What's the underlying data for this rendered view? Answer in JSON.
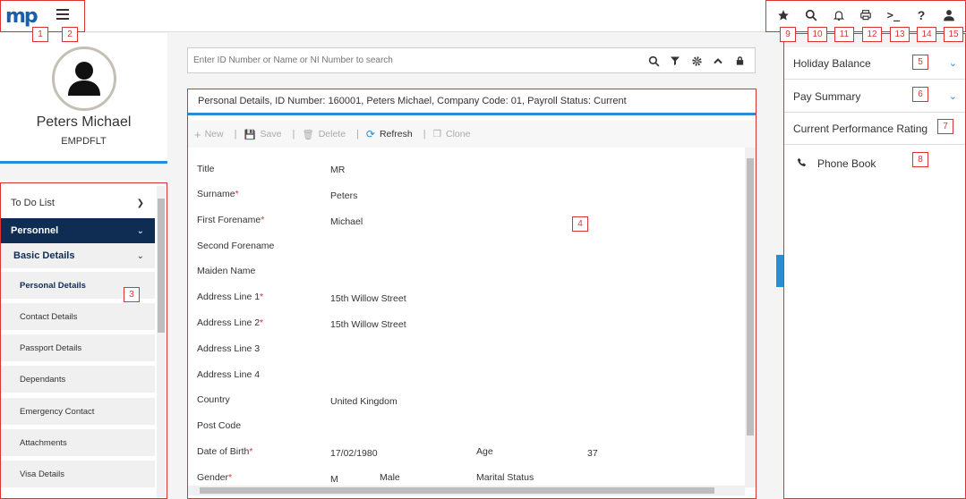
{
  "app": {
    "logo": "mp"
  },
  "top_icons": [
    "star-icon",
    "search-icon",
    "bell-icon",
    "print-icon",
    "terminal-icon",
    "help-icon",
    "user-icon"
  ],
  "annotations": [
    "1",
    "2",
    "3",
    "4",
    "5",
    "6",
    "7",
    "8",
    "9",
    "10",
    "11",
    "12",
    "13",
    "14",
    "15"
  ],
  "profile": {
    "name": "Peters Michael",
    "code": "EMPDFLT"
  },
  "nav": {
    "todo": "To Do List",
    "personnel": "Personnel",
    "basic": "Basic Details",
    "items": [
      "Personal Details",
      "Contact Details",
      "Passport Details",
      "Dependants",
      "Emergency Contact",
      "Attachments",
      "Visa Details"
    ]
  },
  "search": {
    "placeholder": "Enter ID Number or Name or NI Number to search"
  },
  "main": {
    "header": "Personal Details, ID Number: 160001, Peters Michael, Company Code: 01, Payroll Status: Current",
    "toolbar": {
      "new": "New",
      "save": "Save",
      "delete": "Delete",
      "refresh": "Refresh",
      "clone": "Clone"
    },
    "fields": {
      "title_l": "Title",
      "title_v": "MR",
      "surname_l": "Surname",
      "surname_v": "Peters",
      "first_l": "First Forename",
      "first_v": "Michael",
      "second_l": "Second Forename",
      "maiden_l": "Maiden Name",
      "addr1_l": "Address Line 1",
      "addr1_v": "15th Willow Street",
      "addr2_l": "Address Line 2",
      "addr2_v": "15th Willow Street",
      "addr3_l": "Address Line 3",
      "addr4_l": "Address Line 4",
      "country_l": "Country",
      "country_v": "United Kingdom",
      "post_l": "Post Code",
      "dob_l": "Date of Birth",
      "dob_v": "17/02/1980",
      "age_l": "Age",
      "age_v": "37",
      "gender_l": "Gender",
      "gender_code": "M",
      "gender_v": "Male",
      "marital_l": "Marital Status"
    }
  },
  "right": {
    "holiday": "Holiday Balance",
    "pay": "Pay Summary",
    "perf": "Current Performance Rating",
    "phone": "Phone Book"
  },
  "colors": {
    "accent": "#2a8dd4",
    "nav_active": "#0f2d52",
    "annotation": "#d33"
  }
}
